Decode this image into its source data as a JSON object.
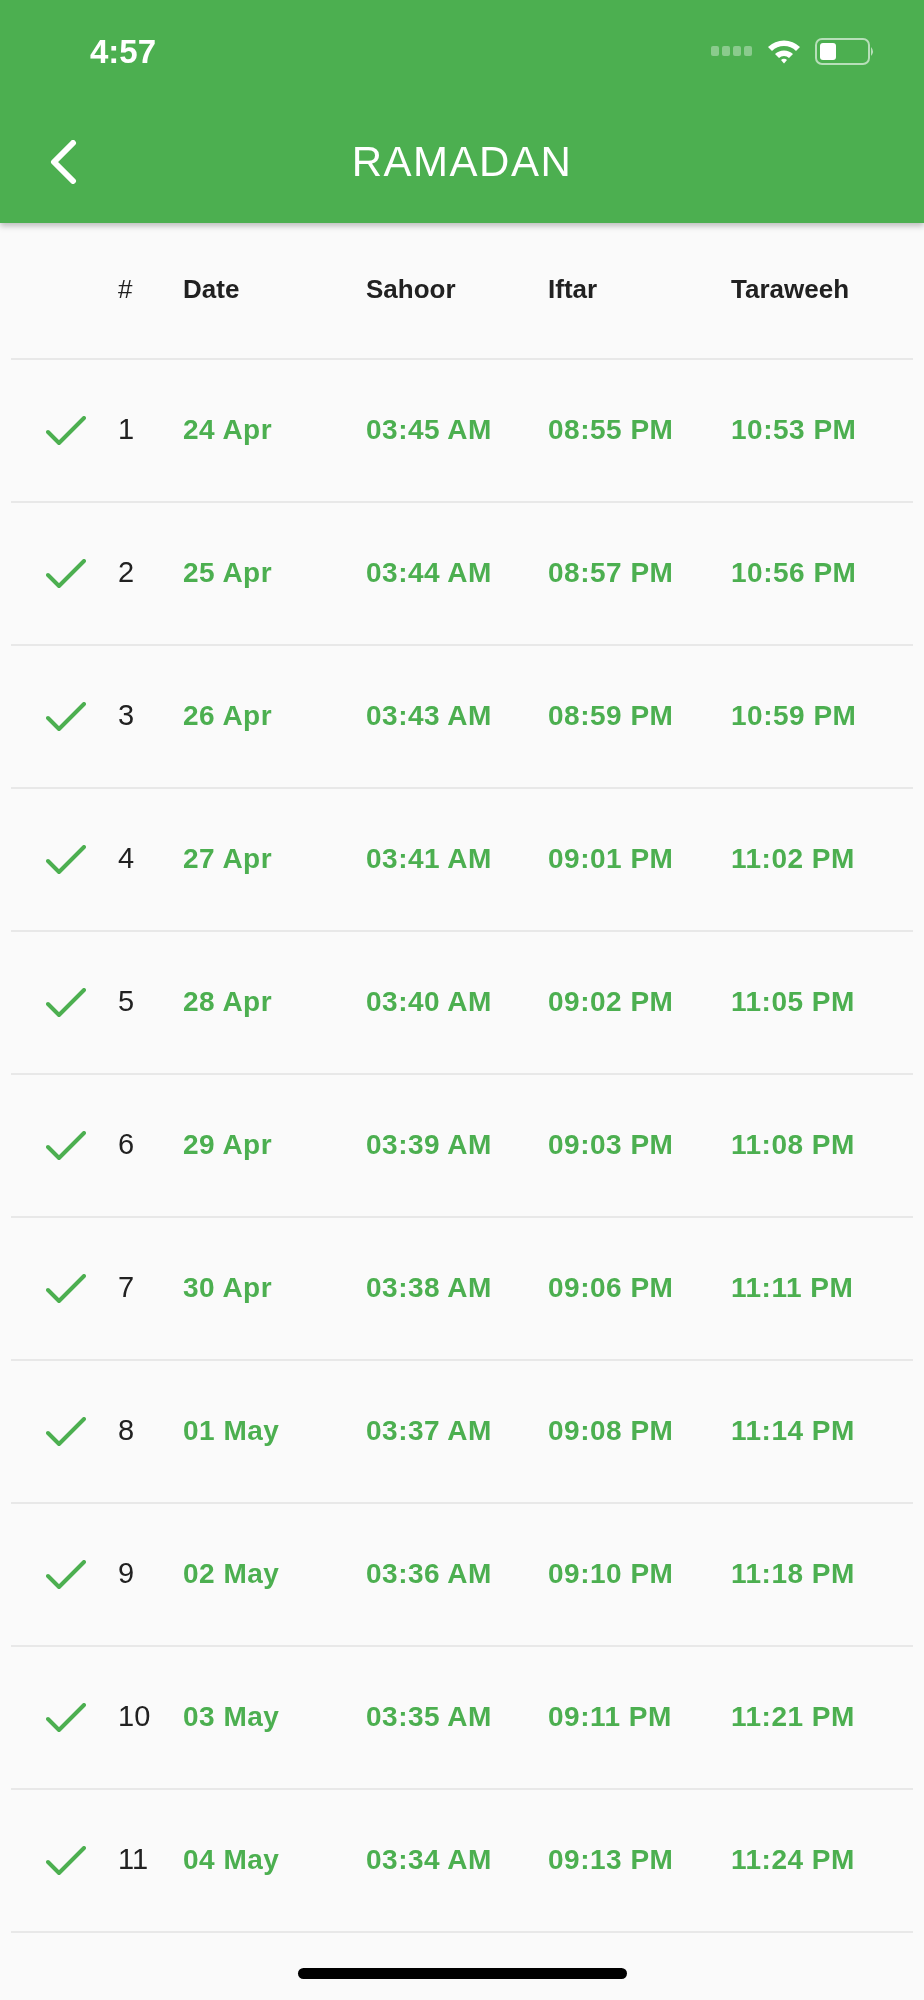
{
  "status_bar": {
    "time": "4:57"
  },
  "app_bar": {
    "title": "RAMADAN"
  },
  "table": {
    "columns": [
      "#",
      "Date",
      "Sahoor",
      "Iftar",
      "Taraweeh"
    ],
    "rows": [
      {
        "checked": true,
        "number": "1",
        "date": "24 Apr",
        "sahoor": "03:45 AM",
        "iftar": "08:55 PM",
        "taraweeh": "10:53 PM"
      },
      {
        "checked": true,
        "number": "2",
        "date": "25 Apr",
        "sahoor": "03:44 AM",
        "iftar": "08:57 PM",
        "taraweeh": "10:56 PM"
      },
      {
        "checked": true,
        "number": "3",
        "date": "26 Apr",
        "sahoor": "03:43 AM",
        "iftar": "08:59 PM",
        "taraweeh": "10:59 PM"
      },
      {
        "checked": true,
        "number": "4",
        "date": "27 Apr",
        "sahoor": "03:41 AM",
        "iftar": "09:01 PM",
        "taraweeh": "11:02 PM"
      },
      {
        "checked": true,
        "number": "5",
        "date": "28 Apr",
        "sahoor": "03:40 AM",
        "iftar": "09:02 PM",
        "taraweeh": "11:05 PM"
      },
      {
        "checked": true,
        "number": "6",
        "date": "29 Apr",
        "sahoor": "03:39 AM",
        "iftar": "09:03 PM",
        "taraweeh": "11:08 PM"
      },
      {
        "checked": true,
        "number": "7",
        "date": "30 Apr",
        "sahoor": "03:38 AM",
        "iftar": "09:06 PM",
        "taraweeh": "11:11 PM"
      },
      {
        "checked": true,
        "number": "8",
        "date": "01 May",
        "sahoor": "03:37 AM",
        "iftar": "09:08 PM",
        "taraweeh": "11:14 PM"
      },
      {
        "checked": true,
        "number": "9",
        "date": "02 May",
        "sahoor": "03:36 AM",
        "iftar": "09:10 PM",
        "taraweeh": "11:18 PM"
      },
      {
        "checked": true,
        "number": "10",
        "date": "03 May",
        "sahoor": "03:35 AM",
        "iftar": "09:11 PM",
        "taraweeh": "11:21 PM"
      },
      {
        "checked": true,
        "number": "11",
        "date": "04 May",
        "sahoor": "03:34 AM",
        "iftar": "09:13 PM",
        "taraweeh": "11:24 PM"
      }
    ]
  }
}
